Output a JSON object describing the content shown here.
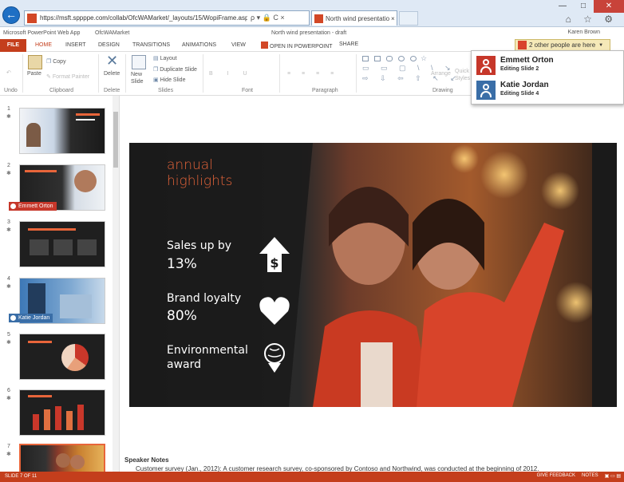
{
  "browser": {
    "url": "https://msft.sppppe.com/collab/OfcWAMarket/_layouts/15/WopiFrame.aspx?sourcedoc=",
    "tab_title": "North wind presentation -...",
    "tab_close": "×",
    "back_glyph": "←",
    "address_controls": "ρ ▾ 🔒 C ×",
    "window_controls": [
      "—",
      "□",
      "✕"
    ],
    "toolbar_icons": "⌂ ☆ ⚙"
  },
  "app": {
    "name": "Microsoft PowerPoint Web App",
    "site": "OfcWAMarket",
    "doc_title": "North wind presentation - draft",
    "user": "Karen Brown"
  },
  "ribbon_tabs": {
    "file": "FILE",
    "tabs": [
      "HOME",
      "INSERT",
      "DESIGN",
      "TRANSITIONS",
      "ANIMATIONS",
      "VIEW"
    ],
    "open_in_ppt": "OPEN IN POWERPOINT",
    "share": "SHARE"
  },
  "presence": {
    "badge": "2 other people are here",
    "people": [
      {
        "name": "Emmett Orton",
        "status": "Editing Slide 2",
        "color": "#c6372a"
      },
      {
        "name": "Katie Jordan",
        "status": "Editing Slide 4",
        "color": "#3a6ea7"
      }
    ]
  },
  "ribbon": {
    "undo_label": "Undo",
    "paste": "Paste",
    "copy": "Copy",
    "format_painter": "Format Painter",
    "clipboard_label": "Clipboard",
    "delete": "Delete",
    "delete_label": "Delete",
    "new_slide": "New\nSlide",
    "layout": "Layout",
    "duplicate_slide": "Duplicate Slide",
    "hide_slide": "Hide Slide",
    "slides_label": "Slides",
    "font_label": "Font",
    "paragraph_label": "Paragraph",
    "arrange": "Arrange",
    "quick_styles": "Quick\nStyles",
    "drawing_label": "Drawing"
  },
  "thumbnails": [
    {
      "num": "1",
      "editor": ""
    },
    {
      "num": "2",
      "editor": "Emmett Orton"
    },
    {
      "num": "3",
      "editor": ""
    },
    {
      "num": "4",
      "editor": "Katie Jordan"
    },
    {
      "num": "5",
      "editor": ""
    },
    {
      "num": "6",
      "editor": ""
    },
    {
      "num": "7",
      "editor": ""
    }
  ],
  "slide": {
    "heading": "annual highlights",
    "stat1_label": "Sales up by",
    "stat1_value": "13%",
    "stat2_label": "Brand loyalty",
    "stat2_value": "80%",
    "stat3_label": "Environmental award"
  },
  "notes": {
    "title": "Speaker Notes",
    "text": "Customer survey (Jan., 2012): A customer research survey, co-sponsored by Contoso and Northwind, was conducted at the beginning of 2012."
  },
  "status": {
    "slide_count": "SLIDE 7 OF 11",
    "feedback": "GIVE FEEDBACK",
    "notes": "NOTES",
    "zoom_icons": "▣ ▭ ▤"
  },
  "colors": {
    "accent": "#c43e1c",
    "slide_heading": "#e8653a"
  }
}
